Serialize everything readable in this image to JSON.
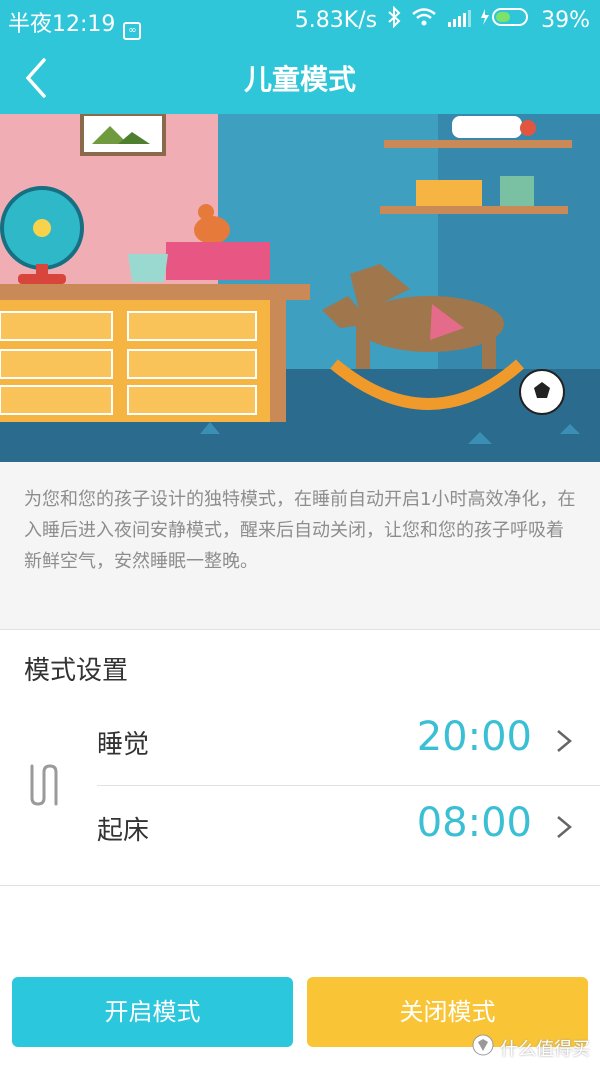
{
  "status_bar": {
    "time": "半夜12:19",
    "speed": "5.83K/s",
    "battery": "39%"
  },
  "app_bar": {
    "title": "儿童模式"
  },
  "description": "为您和您的孩子设计的独特模式，在睡前自动开启1小时高效净化，在入睡后进入夜间安静模式，醒来后自动关闭，让您和您的孩子呼吸着新鲜空气，安然睡眠一整晚。",
  "settings": {
    "title": "模式设置",
    "rows": [
      {
        "label": "睡觉",
        "time": "20:00"
      },
      {
        "label": "起床",
        "time": "08:00"
      }
    ]
  },
  "buttons": {
    "on_label": "开启模式",
    "off_label": "关闭模式"
  },
  "watermark": "什么值得买",
  "colors": {
    "accent": "#2fc6d9",
    "time_text": "#3bbfd4",
    "off_button": "#f9c537"
  }
}
